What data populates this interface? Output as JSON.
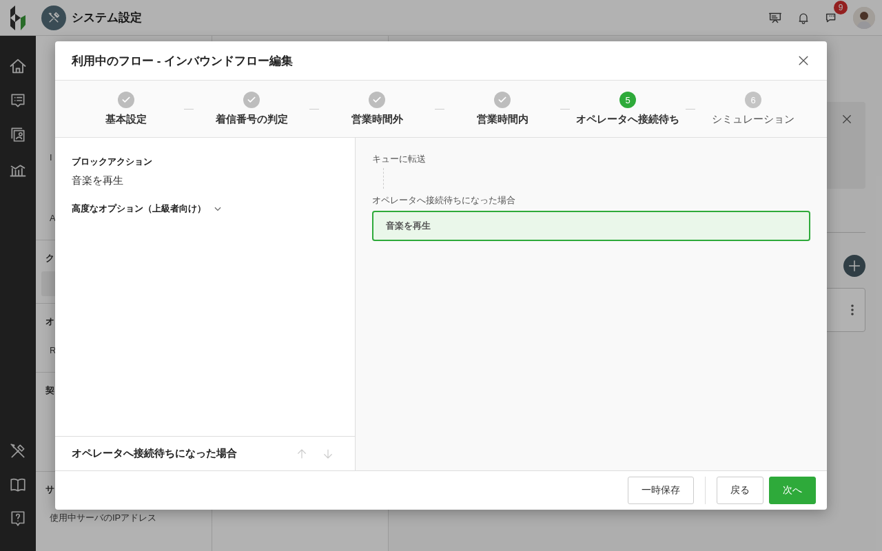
{
  "app": {
    "title": "システム設定",
    "chat_badge": "9"
  },
  "nav": [
    {
      "kind": "item",
      "selected": false
    },
    {
      "kind": "item",
      "selected": false
    },
    {
      "kind": "item",
      "selected": false
    },
    {
      "kind": "item",
      "text": "I",
      "selected": false
    },
    {
      "kind": "item",
      "selected": false
    },
    {
      "kind": "item",
      "text": "A",
      "selected": false
    },
    {
      "kind": "header",
      "text": "ク"
    },
    {
      "kind": "item",
      "selected": true
    },
    {
      "kind": "header",
      "text": "オ"
    },
    {
      "kind": "item",
      "text": "R",
      "selected": false
    },
    {
      "kind": "header",
      "text": "契"
    },
    {
      "kind": "item",
      "selected": false
    },
    {
      "kind": "item",
      "selected": false
    },
    {
      "kind": "header",
      "text": "サ"
    },
    {
      "kind": "item",
      "text": "使用中サーバのIPアドレス",
      "selected": false
    }
  ],
  "dialog": {
    "title": "利用中のフロー - インバウンドフロー編集",
    "steps": [
      {
        "label": "基本設定",
        "completed": true,
        "selected": false
      },
      {
        "label": "着信番号の判定",
        "completed": true,
        "selected": false
      },
      {
        "label": "営業時間外",
        "completed": true,
        "selected": false
      },
      {
        "label": "営業時間内",
        "completed": true,
        "selected": false
      },
      {
        "number": "5",
        "label": "オペレータへ接続待ち",
        "completed": false,
        "selected": true
      },
      {
        "number": "6",
        "label": "シミュレーション",
        "completed": false,
        "selected": false
      }
    ],
    "block_action_label": "ブロックアクション",
    "block_action_value": "音楽を再生",
    "advanced": {
      "label": "高度なオプション（上級者向け）",
      "expanded": false
    },
    "panel_footer_title": "オペレータへ接続待ちになった場合",
    "flow": [
      {
        "kind": "label",
        "text": "キューに転送"
      },
      {
        "kind": "connector"
      },
      {
        "kind": "label",
        "text": "オペレータへ接続待ちになった場合"
      },
      {
        "kind": "block",
        "text": "音楽を再生",
        "selected": true
      }
    ],
    "buttons": [
      {
        "label": "一時保存",
        "kind": "secondary"
      },
      {
        "kind": "separator"
      },
      {
        "label": "戻る",
        "kind": "secondary"
      },
      {
        "label": "次へ",
        "kind": "primary"
      }
    ]
  }
}
